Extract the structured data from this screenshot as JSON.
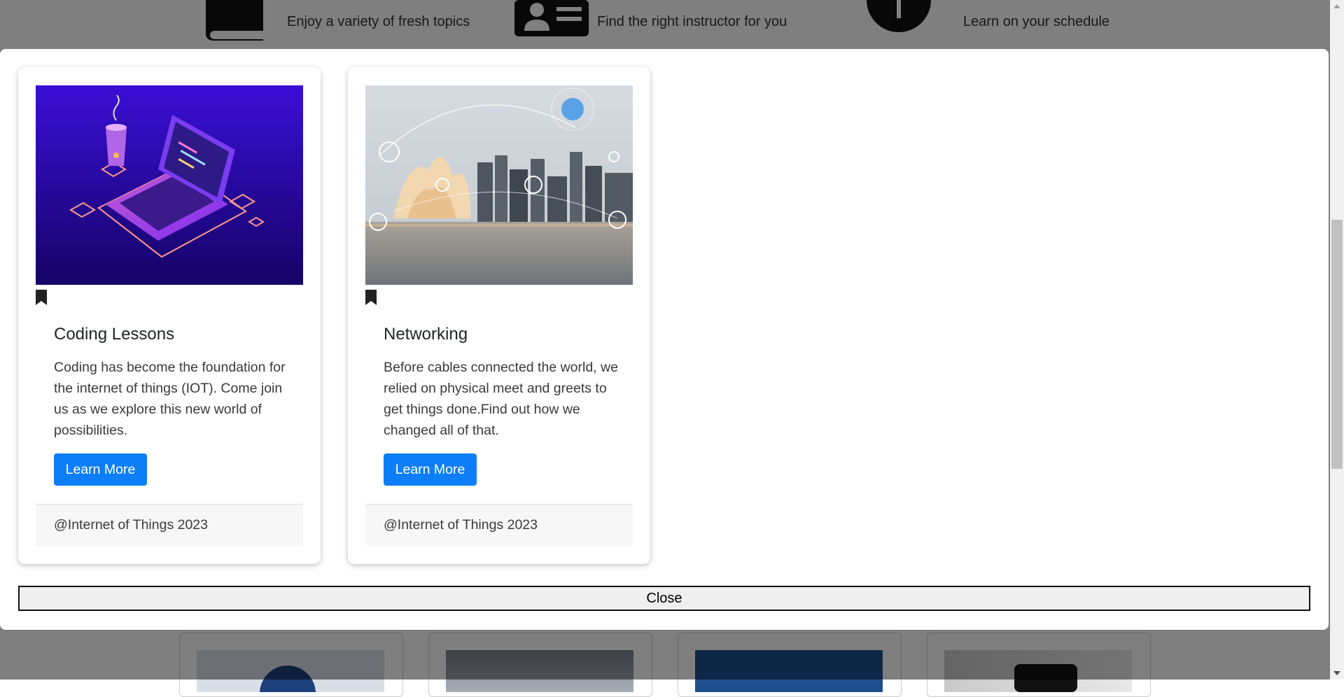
{
  "background": {
    "features": [
      {
        "icon": "book-icon",
        "text": "Enjoy a variety of fresh topics"
      },
      {
        "icon": "id-card-icon",
        "text": "Find the right instructor for you"
      },
      {
        "icon": "clock-icon",
        "text": "Learn on your schedule"
      }
    ]
  },
  "modal": {
    "cards": [
      {
        "title": "Coding Lessons",
        "text": "Coding has become the foundation for the internet of things (IOT). Come join us as we explore this new world of possibilities.",
        "button": "Learn More",
        "footer": "@Internet of Things 2023",
        "image_icon": "laptop-illustration",
        "bookmark_icon": "bookmark-icon"
      },
      {
        "title": "Networking",
        "text": "Before cables connected the world, we relied on physical meet and greets to get things done.Find out how we changed all of that.",
        "button": "Learn More",
        "footer": "@Internet of Things 2023",
        "image_icon": "city-network-photo",
        "bookmark_icon": "bookmark-icon"
      }
    ],
    "close_label": "Close"
  },
  "colors": {
    "primary_button": "#0d7ef7",
    "overlay": "rgba(0,0,0,0.5)"
  }
}
